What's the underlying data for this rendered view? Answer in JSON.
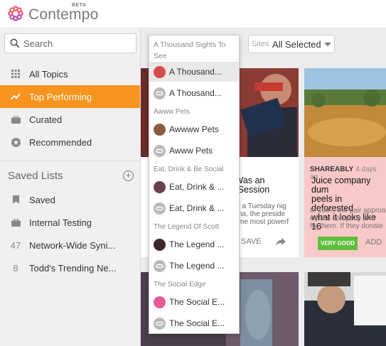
{
  "header": {
    "brand": "Contempo",
    "beta": "BETA"
  },
  "search": {
    "placeholder": "Search"
  },
  "nav": [
    {
      "label": "All Topics",
      "icon": "grid-icon"
    },
    {
      "label": "Top Performing",
      "icon": "trend-icon"
    },
    {
      "label": "Curated",
      "icon": "briefcase-icon"
    },
    {
      "label": "Recommended",
      "icon": "star-circle-icon"
    }
  ],
  "saved_lists": {
    "title": "Saved Lists",
    "items": [
      {
        "icon": "bookmark-icon",
        "label": "Saved"
      },
      {
        "icon": "briefcase-icon",
        "label": "Internal Testing"
      },
      {
        "count": "47",
        "label": "Network-Wide Syni..."
      },
      {
        "count": "8",
        "label": "Todd's Trending Ne..."
      }
    ]
  },
  "sites_filter": {
    "label": "Sites",
    "value": "All Selected"
  },
  "dropdown": {
    "header": "A Thousand Sights To See",
    "groups": [
      {
        "title": "",
        "options": [
          "A Thousand...",
          "A Thousand..."
        ]
      },
      {
        "title": "Awww Pets",
        "options": [
          "Awwww Pets",
          "Awww Pets"
        ]
      },
      {
        "title": "Eat, Drink & Be Social",
        "options": [
          "Eat, Drink & ...",
          "Eat, Drink & ..."
        ]
      },
      {
        "title": "The Legend Of Scott",
        "options": [
          "The Legend ...",
          "The Legend ..."
        ]
      },
      {
        "title": "The Social Edge",
        "options": [
          "The Social E...",
          "The Social E..."
        ]
      }
    ]
  },
  "cards": [
    {
      "title_lines": [
        "ly Was an",
        "by Session"
      ],
      "body_lines": [
        "t a Tuesday nig",
        "na, the preside",
        "me most powerf"
      ],
      "save": "SAVE"
    },
    {
      "meta_label": "SHAREABLY",
      "meta_time": "4 days ag",
      "title_lines": [
        "Juice company dum",
        "peels in deforested",
        "what it looks like 16"
      ],
      "body_lines": [
        "In 1997, the pair approa",
        "e juice company and",
        "for them. If they donate"
      ],
      "good": "VERY GOOD",
      "add": "ADD"
    }
  ],
  "colors": {
    "accent": "#f7941d",
    "good": "#5fbf3a",
    "card_highlight": "#f9c8c8"
  }
}
